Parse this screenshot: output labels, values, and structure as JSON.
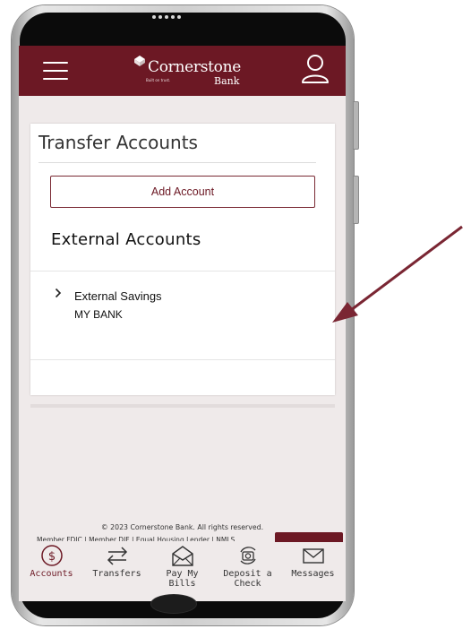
{
  "app": {
    "brand_name": "Cornerstone",
    "brand_suffix": "Bank",
    "brand_tagline": "Built on trust.",
    "accent_color": "#6c1824"
  },
  "header": {
    "menu_icon": "hamburger-icon",
    "profile_icon": "user-icon"
  },
  "page": {
    "title": "Transfer Accounts",
    "add_button_label": "Add Account",
    "section_title": "External Accounts",
    "accounts": [
      {
        "name": "External Savings",
        "bank": "MY BANK",
        "expand_icon": "chevron-right-icon"
      }
    ]
  },
  "footer": {
    "copyright": "© 2023 Cornerstone Bank. All rights reserved.",
    "legal": "Member FDIC | Member DIF | Equal Housing Lender | NMLS"
  },
  "tabbar": {
    "items": [
      {
        "label": "Accounts",
        "icon": "dollar-circle-icon",
        "active": true
      },
      {
        "label": "Transfers",
        "icon": "transfer-arrows-icon",
        "active": false
      },
      {
        "label": "Pay My\nBills",
        "icon": "envelope-open-icon",
        "active": false
      },
      {
        "label": "Deposit a\nCheck",
        "icon": "camera-icon",
        "active": false
      },
      {
        "label": "Messages",
        "icon": "mail-icon",
        "active": false
      }
    ]
  },
  "annotation": {
    "arrow_color": "#7a2633"
  }
}
